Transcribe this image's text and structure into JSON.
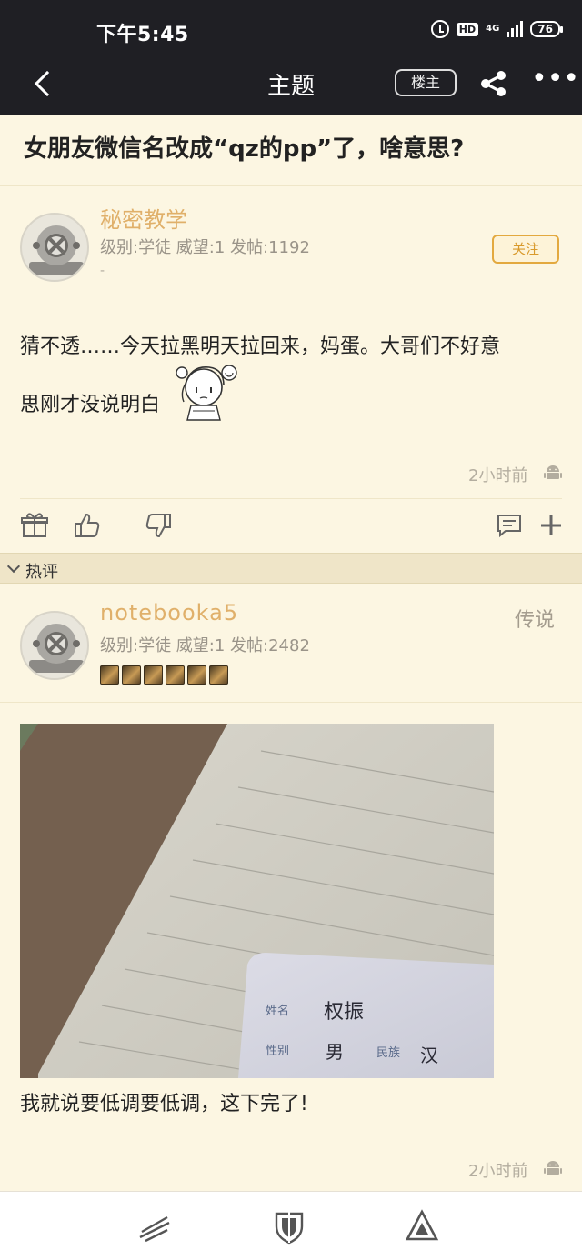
{
  "status_bar": {
    "time": "下午5:45",
    "hd": "HD",
    "network": "4G",
    "battery": "76"
  },
  "header": {
    "title": "主题",
    "owner_button": "楼主"
  },
  "topic": {
    "title": "女朋友微信名改成“qz的pp”了，啥意思?"
  },
  "op": {
    "username": "秘密教学",
    "meta": "级别:学徒 威望:1 发帖:1192",
    "signature": "-",
    "follow_label": "关注",
    "content_line1": "猜不透……今天拉黑明天拉回来，妈蛋。大哥们不好意",
    "content_line2": "思刚才没说明白",
    "time": "2小时前"
  },
  "hot_section": {
    "label": "热评"
  },
  "reply": {
    "username": "notebooka5",
    "meta": "级别:学徒 威望:1 发帖:2482",
    "title_badge": "传说",
    "photo_id_labels": {
      "name_label": "姓名",
      "name_value": "权振",
      "gender_label": "性别",
      "gender_value": "男",
      "ethnicity_label": "民族",
      "ethnicity_value": "汉"
    },
    "content": "我就说要低调要低调，这下完了!",
    "time": "2小时前"
  },
  "colors": {
    "background": "#fcf6e2",
    "header": "#1f1f24",
    "username": "#e0b06a",
    "follow": "#e3a93f"
  },
  "icons": {
    "back": "back-arrow-icon",
    "share": "share-icon",
    "more": "more-icon",
    "gift": "gift-icon",
    "like": "thumb-up-icon",
    "dislike": "thumb-down-icon",
    "comment": "comment-icon",
    "add": "plus-icon",
    "platform": "android-icon"
  }
}
